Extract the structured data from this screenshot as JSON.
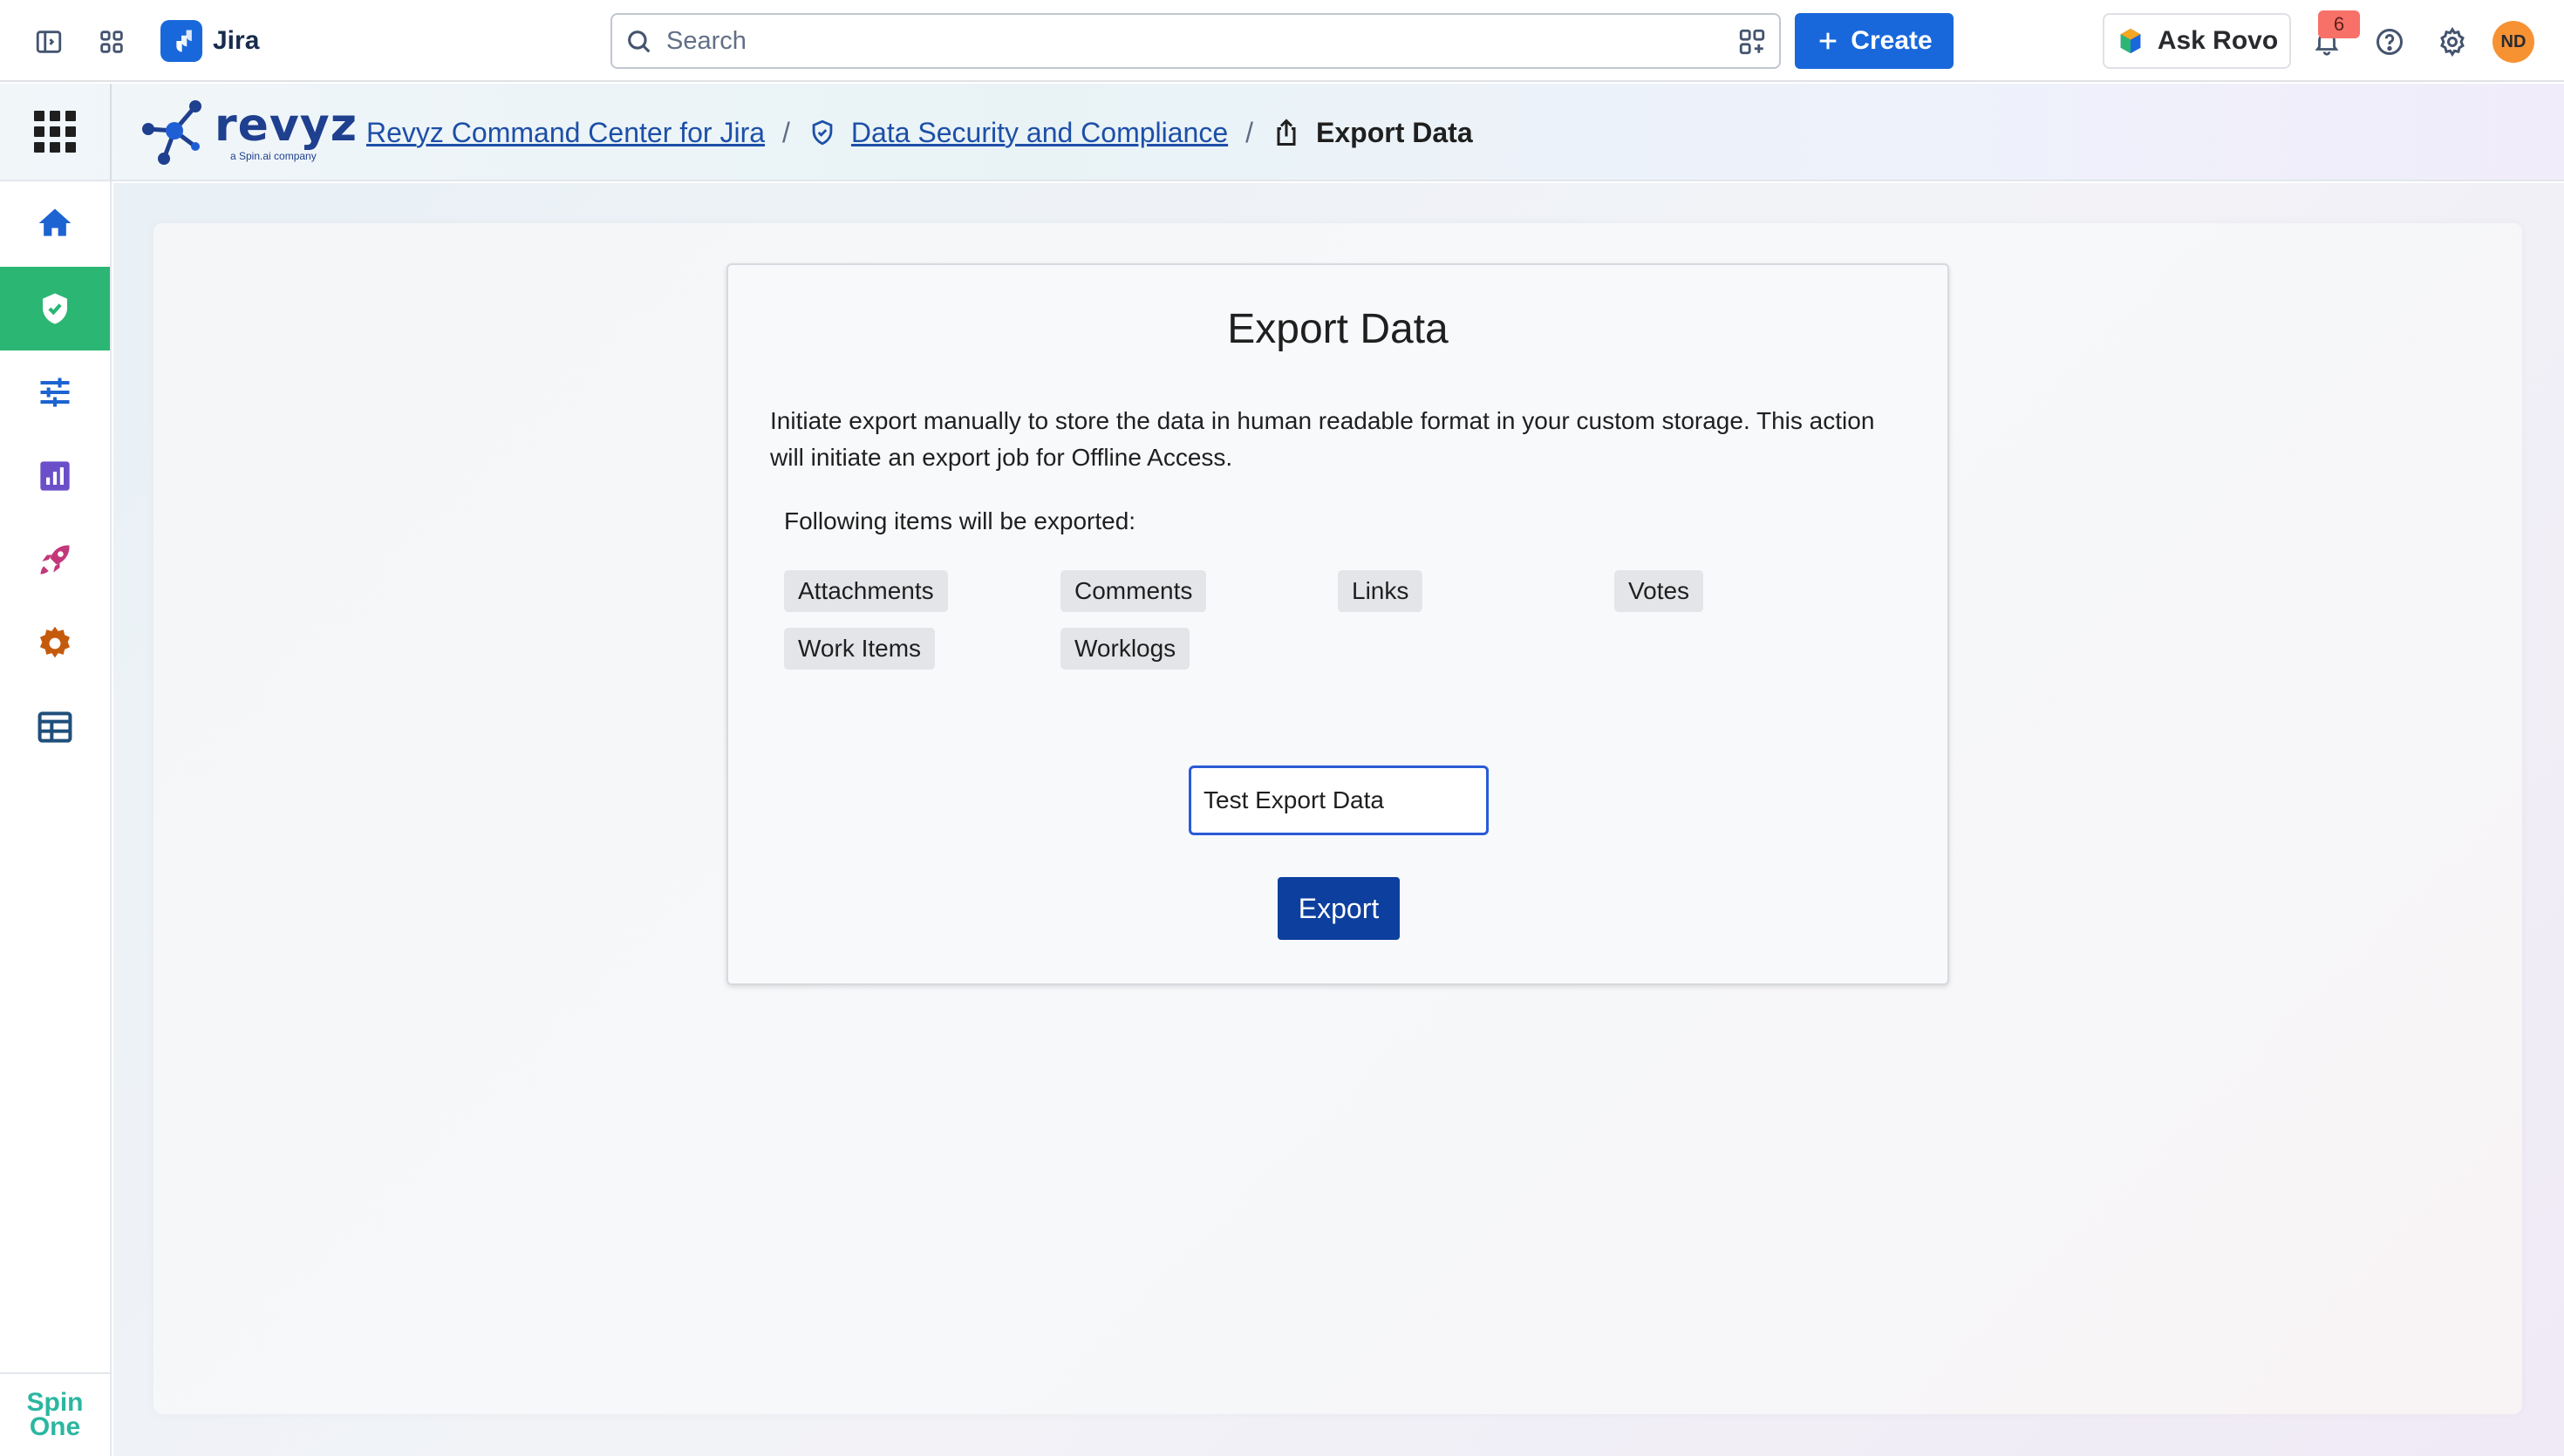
{
  "topbar": {
    "app_name": "Jira",
    "search_placeholder": "Search",
    "create_label": "Create",
    "ask_rovo_label": "Ask Rovo",
    "notification_count": "6",
    "avatar_initials": "ND"
  },
  "header": {
    "brand": "revyz",
    "brand_sub": "a Spin.ai company",
    "breadcrumb": {
      "root": "Revyz Command Center for Jira",
      "parent": "Data Security and Compliance",
      "current": "Export Data",
      "separator": "/"
    }
  },
  "sidebar": {
    "items": [
      {
        "icon": "home-icon",
        "color": "#1d63d1"
      },
      {
        "icon": "shield-check-icon",
        "color": "#ffffff",
        "active": true
      },
      {
        "icon": "sliders-icon",
        "color": "#1d63d1"
      },
      {
        "icon": "report-chart-icon",
        "color": "#6b4fc9"
      },
      {
        "icon": "rocket-icon",
        "color": "#c2387a"
      },
      {
        "icon": "gear-icon",
        "color": "#c45a0c"
      },
      {
        "icon": "table-view-icon",
        "color": "#1f4f7a"
      }
    ],
    "footer_line1": "Spin",
    "footer_line2": "One"
  },
  "card": {
    "title": "Export Data",
    "description": "Initiate export manually to store the data in human readable format in your custom storage. This action will initiate an export job for Offline Access.",
    "items_heading": "Following items will be exported:",
    "items": [
      "Attachments",
      "Comments",
      "Links",
      "Votes",
      "Work Items",
      "Worklogs"
    ],
    "name_value": "Test Export Data",
    "export_label": "Export"
  },
  "colors": {
    "jira_blue": "#1868db",
    "active_green": "#2bb673",
    "export_button": "#0d3f9e",
    "link": "#1d4fa8"
  }
}
